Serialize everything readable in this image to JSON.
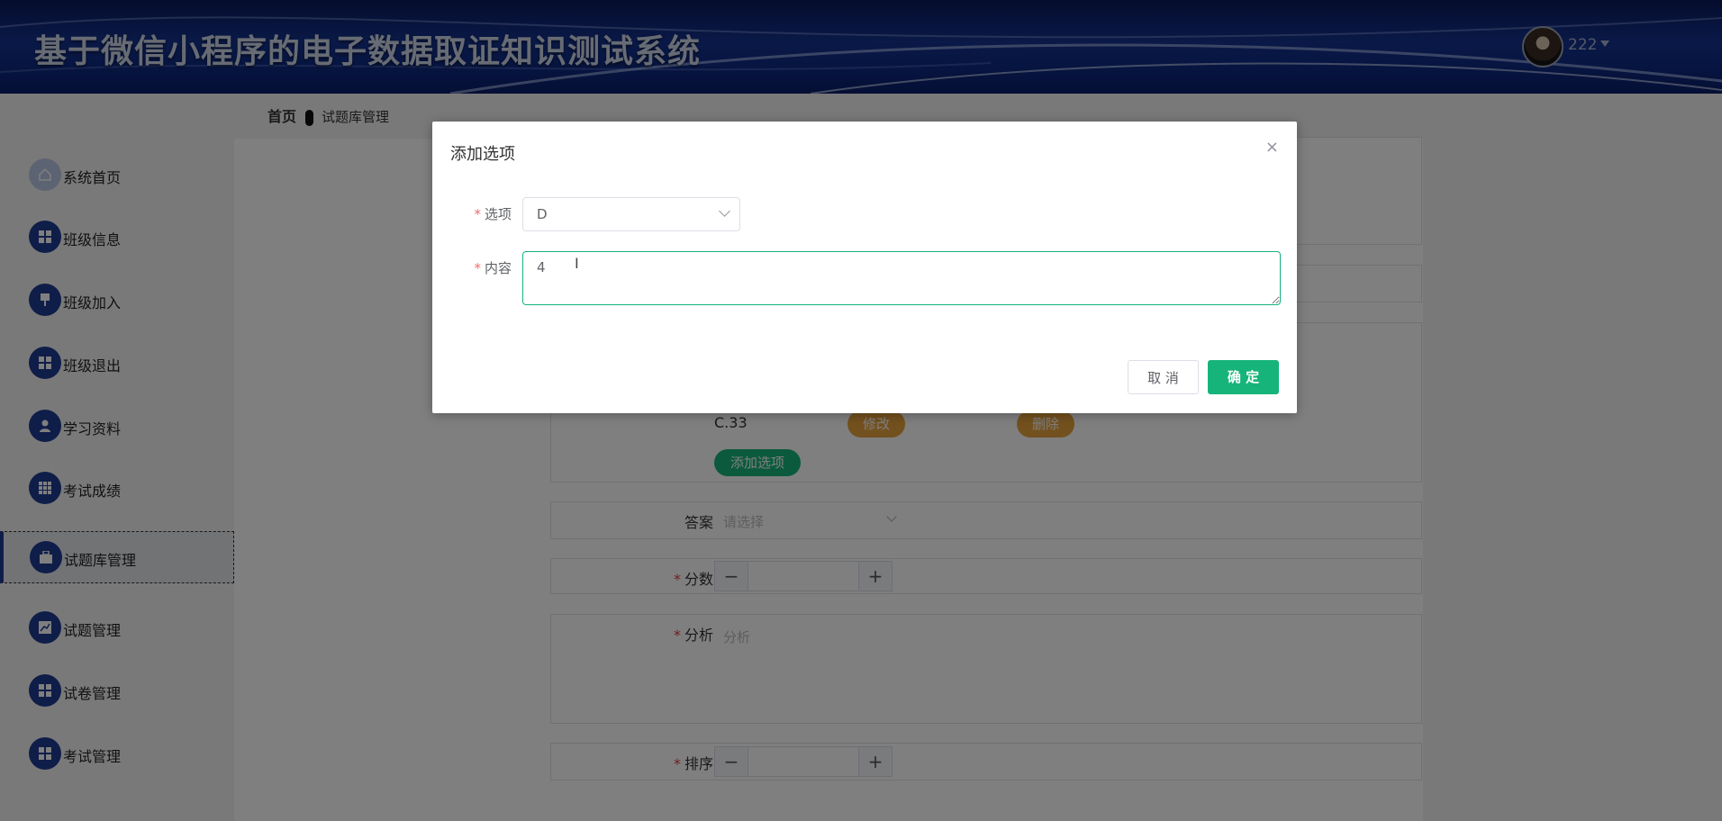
{
  "header": {
    "title": "基于微信小程序的电子数据取证知识测试系统",
    "username": "222"
  },
  "breadcrumb": {
    "home": "首页",
    "current": "试题库管理"
  },
  "sidebar": {
    "items": [
      {
        "label": "系统首页",
        "icon": "home-icon"
      },
      {
        "label": "班级信息",
        "icon": "grid-icon"
      },
      {
        "label": "班级加入",
        "icon": "pin-icon"
      },
      {
        "label": "班级退出",
        "icon": "grid-icon"
      },
      {
        "label": "学习资料",
        "icon": "user-icon"
      },
      {
        "label": "考试成绩",
        "icon": "table-icon"
      },
      {
        "label": "试题库管理",
        "icon": "briefcase-icon",
        "active": true
      },
      {
        "label": "试题管理",
        "icon": "chart-icon"
      },
      {
        "label": "试卷管理",
        "icon": "grid-icon"
      },
      {
        "label": "考试管理",
        "icon": "grid-icon"
      }
    ]
  },
  "form": {
    "option_text": "C.33",
    "edit_label": "修改",
    "delete_label": "删除",
    "add_option_label": "添加选项",
    "answer_label": "答案",
    "answer_placeholder": "请选择",
    "score_label": "分数",
    "analysis_label": "分析",
    "analysis_placeholder": "分析",
    "sort_label": "排序",
    "minus": "−",
    "plus": "+"
  },
  "dialog": {
    "title": "添加选项",
    "close": "×",
    "option_label": "选项",
    "option_value": "D",
    "content_label": "内容",
    "content_value": "4",
    "cancel_label": "取 消",
    "confirm_label": "确 定",
    "required_mark": "*"
  },
  "colors": {
    "header_bg": "#14328f",
    "accent_green": "#16b47a",
    "orange": "#e6a23c",
    "required": "#f56c6c"
  }
}
